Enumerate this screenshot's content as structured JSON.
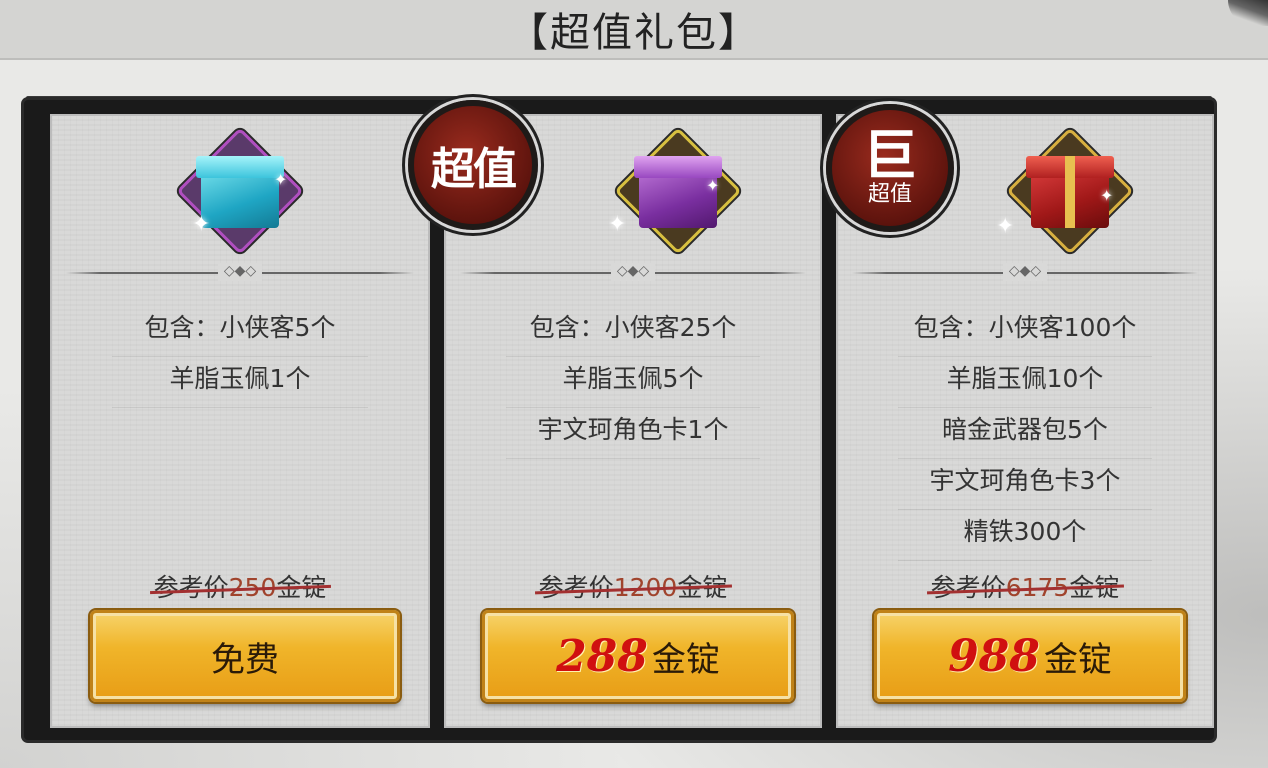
{
  "header": {
    "title": "【超值礼包】"
  },
  "packs": [
    {
      "icon": "cyan-gift-box-icon",
      "items": [
        "包含：小侠客5个",
        "羊脂玉佩1个"
      ],
      "ref_price": {
        "prefix": "参考价",
        "value": "250",
        "unit": "金锭"
      },
      "button": {
        "label": "免费"
      }
    },
    {
      "icon": "purple-gift-box-icon",
      "badge": {
        "text": "超值"
      },
      "items": [
        "包含：小侠客25个",
        "羊脂玉佩5个",
        "宇文珂角色卡1个"
      ],
      "ref_price": {
        "prefix": "参考价",
        "value": "1200",
        "unit": "金锭"
      },
      "button": {
        "price": "288",
        "unit": "金锭"
      }
    },
    {
      "icon": "red-gift-box-icon",
      "badge": {
        "char": "巨",
        "text": "超值"
      },
      "items": [
        "包含：小侠客100个",
        "羊脂玉佩10个",
        "暗金武器包5个",
        "宇文珂角色卡3个",
        "精铁300个"
      ],
      "ref_price": {
        "prefix": "参考价",
        "value": "6175",
        "unit": "金锭"
      },
      "button": {
        "price": "988",
        "unit": "金锭"
      }
    }
  ],
  "colors": {
    "button_gold": "#f0b52a",
    "price_red": "#d01010",
    "seal_red": "#8a2418",
    "frame_ink": "#1a1a1a"
  }
}
